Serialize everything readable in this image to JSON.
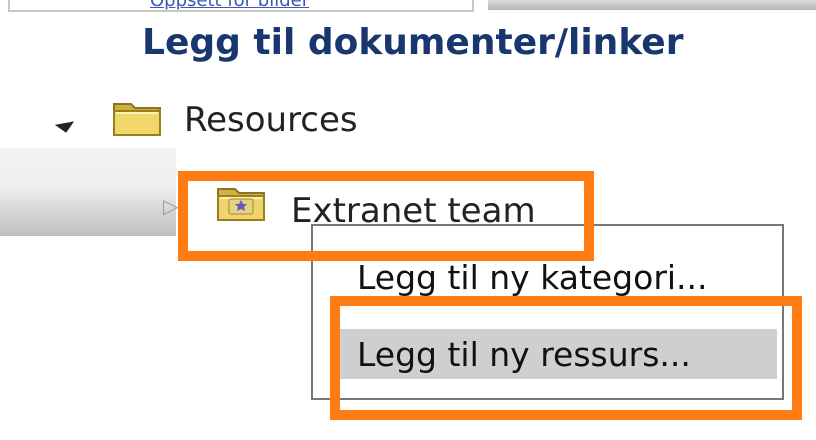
{
  "top_strip": {
    "link_text": "Oppsett for bilder",
    "link_color": "#3a58b5"
  },
  "title": "Legg til dokumenter/linker",
  "tree": {
    "root": {
      "label": "Resources",
      "icon": "folder-icon",
      "expanded_indicator": "◢"
    },
    "child": {
      "label": "Extranet team",
      "icon": "team-folder-icon",
      "collapsed_indicator": "▷"
    }
  },
  "context_menu": {
    "items": [
      {
        "label": "Legg til ny kategori..."
      },
      {
        "label": "Legg til ny ressurs..."
      }
    ]
  },
  "colors": {
    "title_color": "#19376f",
    "highlight_orange": "#ff7b14",
    "menu_highlight": "#cfcfcf",
    "menu_border": "#777777"
  }
}
